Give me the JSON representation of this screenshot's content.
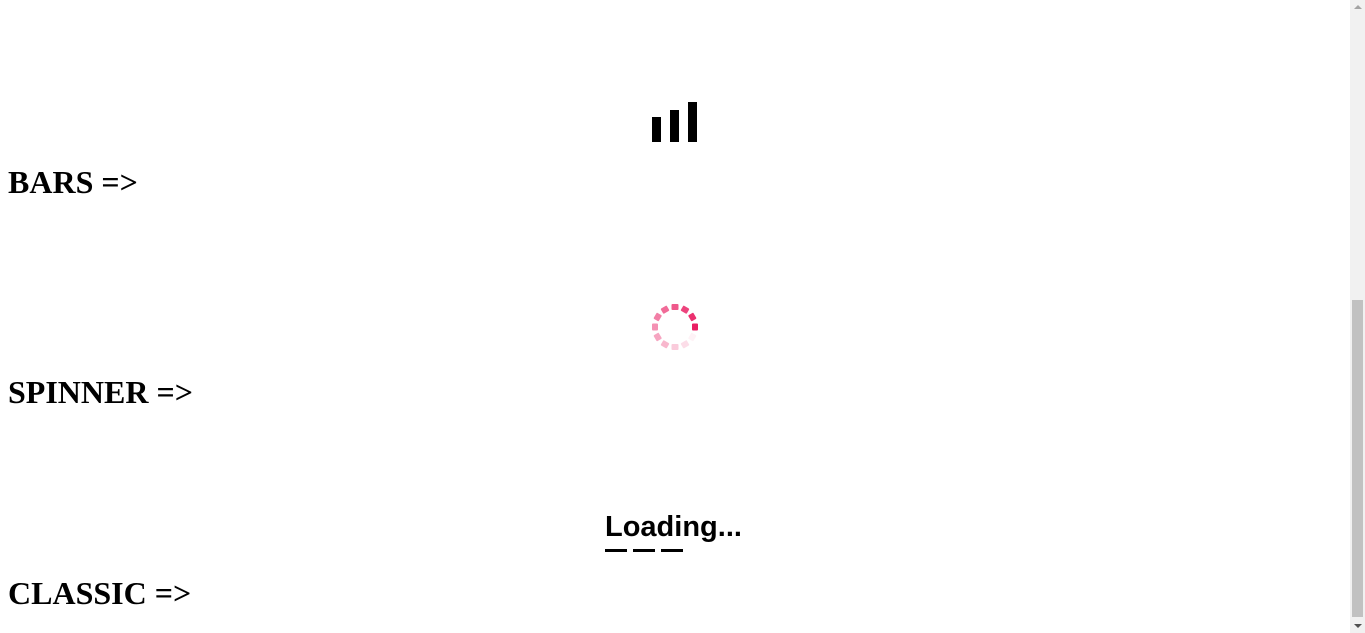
{
  "sections": {
    "bars": {
      "heading": "BARS =>"
    },
    "spinner": {
      "heading": "SPINNER =>"
    },
    "classic": {
      "heading": "CLASSIC =>",
      "loader_text": "Loading..."
    }
  },
  "colors": {
    "text": "#000000",
    "spinner_accent": "#e91e63",
    "background": "#ffffff",
    "scrollbar_track": "#f1f1f1",
    "scrollbar_thumb": "#c1c1c1"
  },
  "icons": {
    "bars": "bars-loader-icon",
    "spinner": "spinner-loader-icon",
    "classic": "classic-dash-loader-icon",
    "scroll_up": "arrow-up-icon",
    "scroll_down": "arrow-down-icon"
  },
  "scroll": {
    "position_fraction": 1.0,
    "visible_fraction": 0.5
  }
}
